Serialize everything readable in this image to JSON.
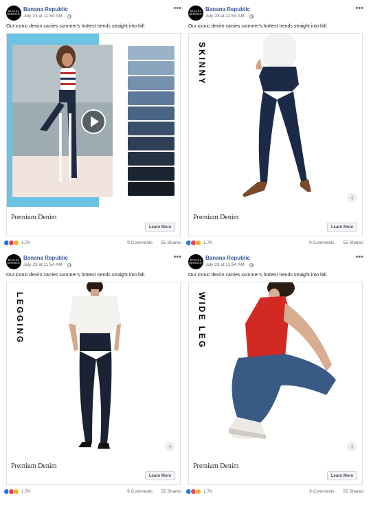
{
  "posts": [
    {
      "page_name": "Banana Republic",
      "avatar_text": "BANANA REPUBLIC",
      "timestamp": "July 23 at 11:54 AM · ",
      "text": "Our iconic denim carries summer's hottest trends straight into fall.",
      "headline": "Premium Denim",
      "cta": "Learn More",
      "style_label": "",
      "reaction_count": "1.7K",
      "comments": "9 Comments",
      "shares": "55 Shares"
    },
    {
      "page_name": "Banana Republic",
      "avatar_text": "BANANA REPUBLIC",
      "timestamp": "July 23 at 11:54 AM · ",
      "text": "Our iconic denim carries summer's hottest trends straight into fall.",
      "headline": "Premium Denim",
      "cta": "Learn More",
      "style_label": "SKINNY",
      "reaction_count": "1.7K",
      "comments": "9 Comments",
      "shares": "55 Shares"
    },
    {
      "page_name": "Banana Republic",
      "avatar_text": "BANANA REPUBLIC",
      "timestamp": "July 23 at 11:54 AM · ",
      "text": "Our iconic denim carries summer's hottest trends straight into fall.",
      "headline": "Premium Denim",
      "cta": "Learn More",
      "style_label": "LEGGING",
      "reaction_count": "1.7K",
      "comments": "9 Comments",
      "shares": "55 Shares"
    },
    {
      "page_name": "Banana Republic",
      "avatar_text": "BANANA REPUBLIC",
      "timestamp": "July 23 at 11:54 AM · ",
      "text": "Our iconic denim carries summer's hottest trends straight into fall.",
      "headline": "Premium Denim",
      "cta": "Learn More",
      "style_label": "WIDE LEG",
      "reaction_count": "1.7K",
      "comments": "9 Comments",
      "shares": "55 Shares"
    }
  ],
  "icons": {
    "more": "more-options-icon",
    "globe": "globe-icon",
    "play": "play-icon",
    "carousel": "carousel-prev-icon",
    "reactions": [
      "like-icon",
      "love-icon",
      "haha-icon"
    ]
  },
  "colors": {
    "page_name": "#385898",
    "like": "#1877f2",
    "love": "#f33e58",
    "haha": "#f7b125",
    "accent_panel": "#6cc3e3"
  }
}
